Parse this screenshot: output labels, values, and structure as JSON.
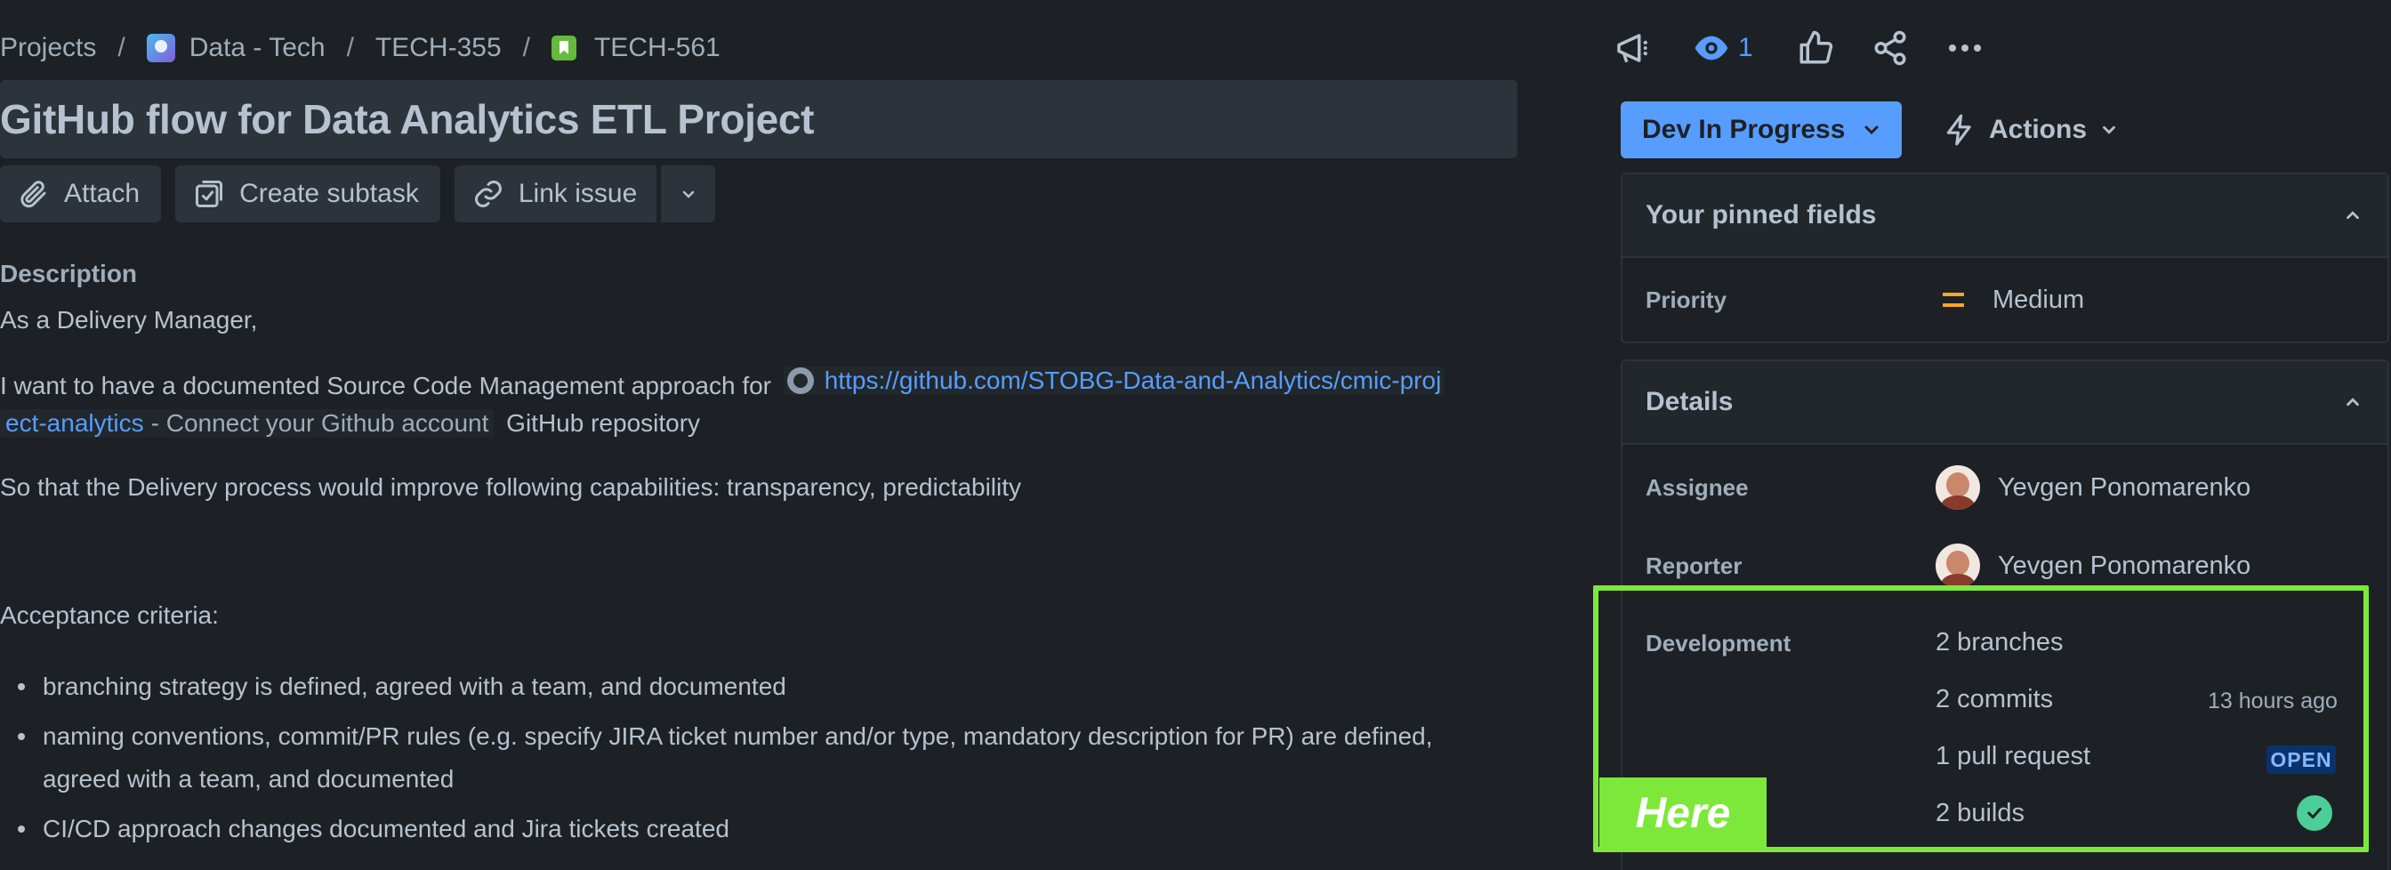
{
  "breadcrumb": {
    "projects": "Projects",
    "separator": "/",
    "project": "Data - Tech",
    "parent": "TECH-355",
    "issue": "TECH-561"
  },
  "issue": {
    "title": "GitHub flow for Data Analytics ETL Project"
  },
  "toolbar": {
    "attach": "Attach",
    "create_subtask": "Create subtask",
    "link_issue": "Link issue"
  },
  "description": {
    "heading": "Description",
    "line1": "As a Delivery Manager,",
    "line2_prefix": "I want to have a documented Source Code Management approach for",
    "link_part1": "https://github.com/STOBG-Data-and-Analytics/cmic-proj",
    "link_part2": "ect-analytics",
    "link_suffix": "- Connect your Github account",
    "line2_end": "GitHub repository",
    "line3": "So that the Delivery process would improve following capabilities: transparency, predictability",
    "acceptance_heading": "Acceptance criteria:",
    "criteria": [
      "branching strategy is defined, agreed with a team, and documented",
      "naming conventions, commit/PR rules (e.g. specify JIRA ticket number and/or type, mandatory description for PR) are defined,",
      "agreed with a team, and documented",
      "CI/CD approach changes documented and Jira tickets created"
    ]
  },
  "header_actions": {
    "watch_count": "1",
    "icons": [
      "megaphone-icon",
      "eye-icon",
      "thumbs-up-icon",
      "share-icon",
      "more-icon"
    ]
  },
  "status": {
    "label": "Dev In Progress",
    "actions_label": "Actions"
  },
  "pinned": {
    "heading": "Your pinned fields",
    "priority_label": "Priority",
    "priority_value": "Medium"
  },
  "details": {
    "heading": "Details",
    "assignee_label": "Assignee",
    "assignee": "Yevgen Ponomarenko",
    "reporter_label": "Reporter",
    "reporter": "Yevgen Ponomarenko",
    "development_label": "Development",
    "branches": "2 branches",
    "commits": "2 commits",
    "commits_time": "13 hours ago",
    "pull_request": "1 pull request",
    "pr_status": "OPEN",
    "builds": "2 builds"
  },
  "annotation": {
    "tag": "Here"
  },
  "colors": {
    "background": "#1d2125",
    "accent": "#579dff",
    "highlight": "#7ee83a",
    "success": "#4bce97",
    "priority": "#f5a623"
  }
}
